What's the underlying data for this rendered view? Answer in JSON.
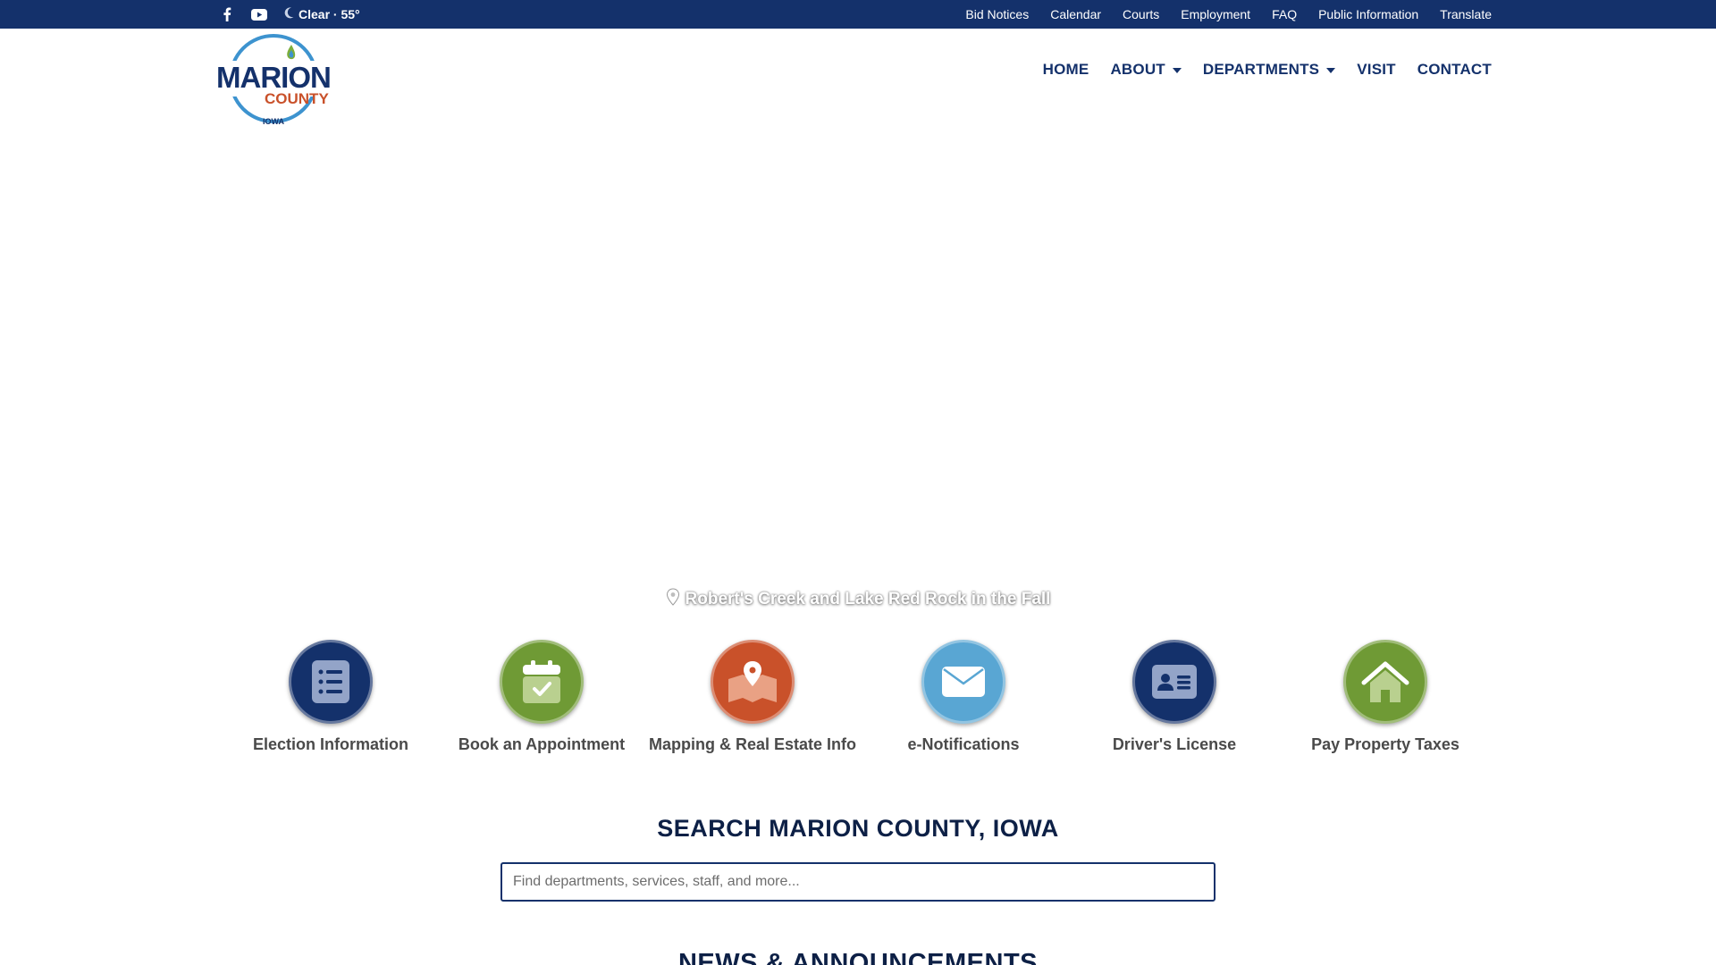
{
  "topbar": {
    "weather": "Clear · 55°",
    "links": [
      "Bid Notices",
      "Calendar",
      "Courts",
      "Employment",
      "FAQ",
      "Public Information",
      "Translate"
    ],
    "social_icons": [
      "facebook-icon",
      "youtube-icon"
    ]
  },
  "logo": {
    "line1": "MARION",
    "line2": "COUNTY",
    "line3": "IOWA"
  },
  "nav": {
    "home": "HOME",
    "about": "ABOUT",
    "departments": "DEPARTMENTS",
    "visit": "VISIT",
    "contact": "CONTACT"
  },
  "hero": {
    "caption": "Robert's Creek and Lake Red Rock in the Fall"
  },
  "quicklinks": [
    {
      "label": "Election Information",
      "icon": "list-icon",
      "color": "#14316b"
    },
    {
      "label": "Book an Appointment",
      "icon": "calendar-check-icon",
      "color": "#6f9a35"
    },
    {
      "label": "Mapping & Real Estate Info",
      "icon": "map-pin-icon",
      "color": "#c9512a"
    },
    {
      "label": "e-Notifications",
      "icon": "envelope-icon",
      "color": "#59a6d3"
    },
    {
      "label": "Driver's License",
      "icon": "id-card-icon",
      "color": "#14316b"
    },
    {
      "label": "Pay Property Taxes",
      "icon": "house-icon",
      "color": "#6f9a35"
    }
  ],
  "search": {
    "title": "SEARCH MARION COUNTY, IOWA",
    "placeholder": "Find departments, services, staff, and more..."
  },
  "news": {
    "title": "NEWS & ANNOUNCEMENTS"
  },
  "colors": {
    "navy": "#14316b",
    "green": "#6f9a35",
    "orange": "#c9512a",
    "lightblue": "#59a6d3"
  }
}
